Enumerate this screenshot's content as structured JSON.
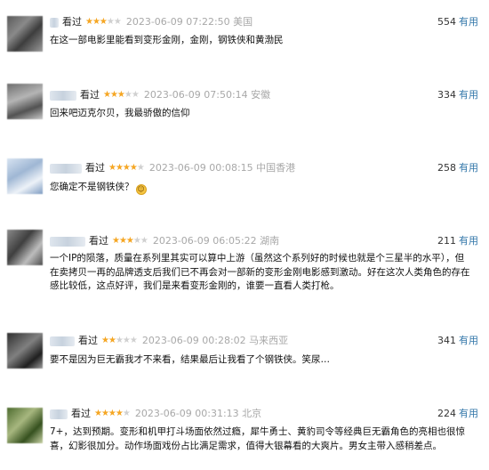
{
  "comments": [
    {
      "status": "看过",
      "rating": 3,
      "time": "2023-06-09 07:22:50 美国",
      "votes": "554",
      "useful_label": "有用",
      "text": "在这一部电影里能看到变形金刚，金刚，钢铁侠和黄渤民"
    },
    {
      "status": "看过",
      "rating": 3,
      "time": "2023-06-09 07:50:14 安徽",
      "votes": "334",
      "useful_label": "有用",
      "text": "回来吧迈克尔贝，我最骄傲的信仰"
    },
    {
      "status": "看过",
      "rating": 4,
      "time": "2023-06-09 00:08:15 中国香港",
      "votes": "258",
      "useful_label": "有用",
      "text": "您确定不是钢铁侠？",
      "emoji": "smiley-emoji"
    },
    {
      "status": "看过",
      "rating": 3,
      "time": "2023-06-09 06:05:22 湖南",
      "votes": "211",
      "useful_label": "有用",
      "text": "一个IP的陨落，质量在系列里其实可以算中上游（虽然这个系列好的时候也就是个三星半的水平），但在卖拷贝一再的品牌透支后我们已不再会对一部新的变形金刚电影感到激动。好在这次人类角色的存在感比较低，这点好评，我们是来看变形金刚的，谁要一直看人类打枪。"
    },
    {
      "status": "看过",
      "rating": 2,
      "time": "2023-06-09 00:28:02 马来西亚",
      "votes": "341",
      "useful_label": "有用",
      "text": "要不是因为巨无霸我才不来看，结果最后让我看了个钢铁侠。笑尿…"
    },
    {
      "status": "看过",
      "rating": 4,
      "time": "2023-06-09 00:31:13 北京",
      "votes": "224",
      "useful_label": "有用",
      "text": "7+，达到预期。变形和机甲打斗场面依然过瘾，犀牛勇士、黄豹司令等经典巨无霸角色的亮相也很惊喜，幻影很加分。动作场面戏份占比满足需求，值得大银幕看的大爽片。男女主带入感稍差点。"
    }
  ]
}
